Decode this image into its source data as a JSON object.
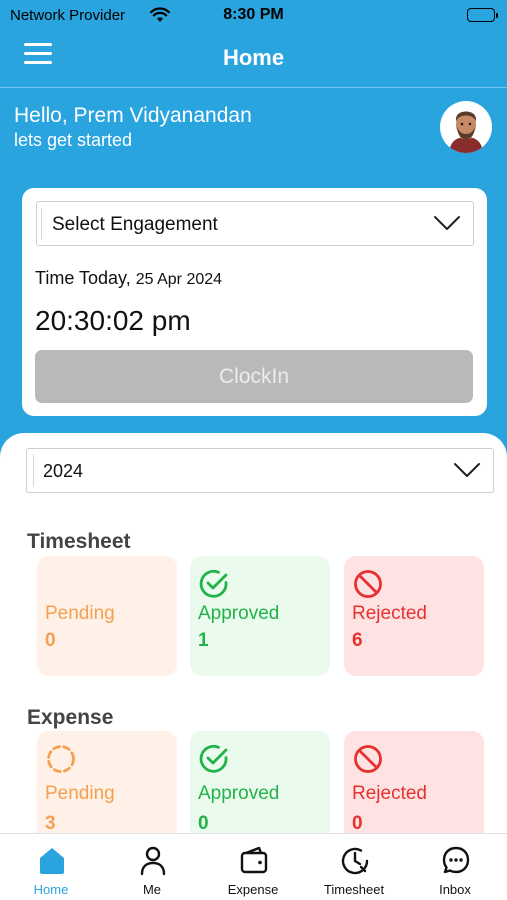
{
  "status_bar": {
    "carrier": "Network Provider",
    "time": "8:30 PM"
  },
  "header": {
    "title": "Home"
  },
  "greeting": {
    "hello": "Hello, Prem Vidyanandan",
    "subtitle": "lets get started"
  },
  "engagement_card": {
    "select_label": "Select Engagement",
    "time_today_label": "Time Today,",
    "date": "25 Apr 2024",
    "clock": "20:30:02 pm",
    "clockin_label": "ClockIn"
  },
  "year_filter": {
    "value": "2024"
  },
  "timesheet": {
    "title": "Timesheet",
    "pending": {
      "label": "Pending",
      "count": "0"
    },
    "approved": {
      "label": "Approved",
      "count": "1"
    },
    "rejected": {
      "label": "Rejected",
      "count": "6"
    }
  },
  "expense": {
    "title": "Expense",
    "pending": {
      "label": "Pending",
      "count": "3"
    },
    "approved": {
      "label": "Approved",
      "count": "0"
    },
    "rejected": {
      "label": "Rejected",
      "count": "0"
    }
  },
  "tabs": [
    {
      "label": "Home",
      "icon": "home-icon",
      "active": true
    },
    {
      "label": "Me",
      "icon": "person-icon"
    },
    {
      "label": "Expense",
      "icon": "wallet-icon"
    },
    {
      "label": "Timesheet",
      "icon": "clock-icon"
    },
    {
      "label": "Inbox",
      "icon": "chat-icon"
    }
  ],
  "colors": {
    "primary": "#29a4df",
    "pending": "#f5a04e",
    "approved": "#21b24a",
    "rejected": "#e93030",
    "button_disabled": "#b9b9b9"
  }
}
